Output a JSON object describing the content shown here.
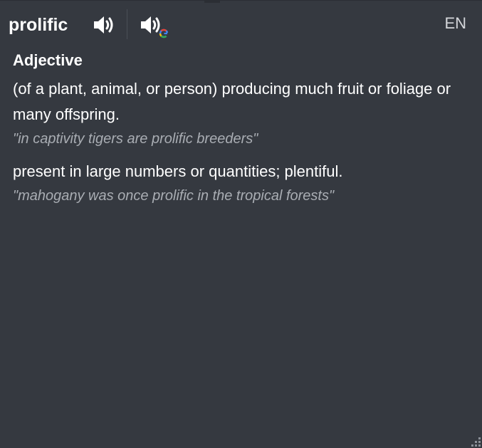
{
  "header": {
    "word": "prolific",
    "speak_icon": "speaker-icon",
    "google_speak_icon": "google-speaker-icon",
    "language": "EN"
  },
  "entry": {
    "part_of_speech": "Adjective",
    "senses": [
      {
        "definition": "(of a plant, animal, or person) producing much fruit or foliage or many offspring.",
        "example": "\"in captivity tigers are prolific breeders\""
      },
      {
        "definition": "present in large numbers or quantities; plentiful.",
        "example": "\"mahogany was once prolific in the tropical forests\""
      }
    ]
  },
  "colors": {
    "background": "#353940",
    "text": "#ffffff",
    "example_text": "#a9adb3",
    "lang_text": "#d4d6da"
  }
}
